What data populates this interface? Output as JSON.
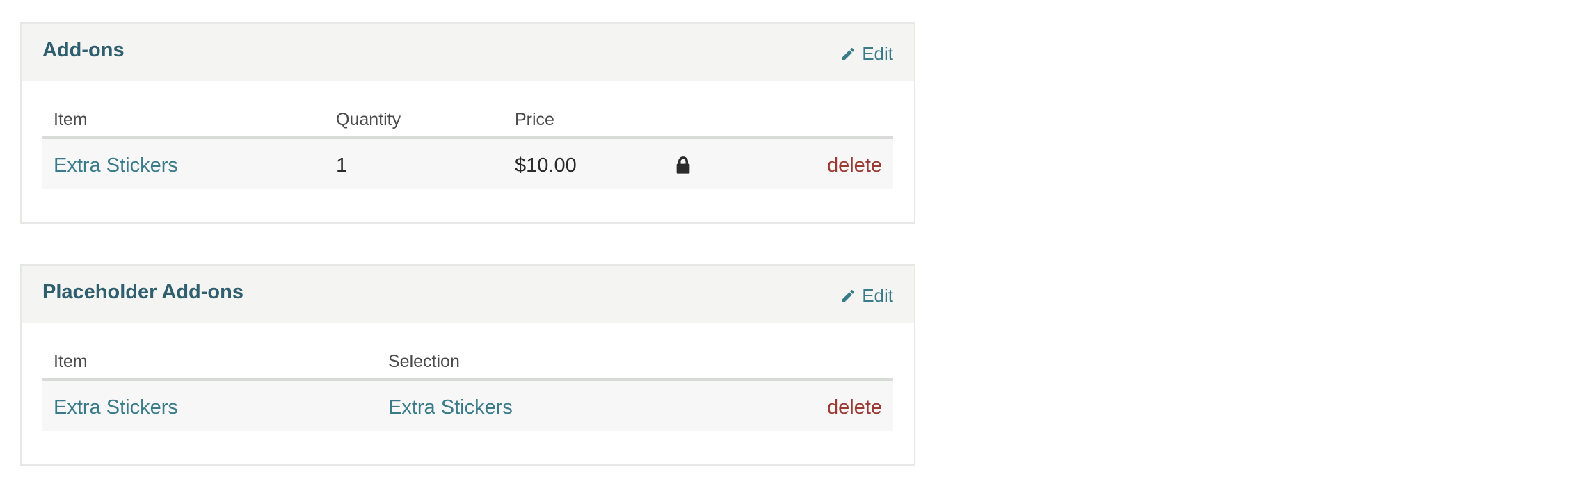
{
  "addons": {
    "title": "Add-ons",
    "edit_label": "Edit",
    "columns": {
      "item": "Item",
      "quantity": "Quantity",
      "price": "Price"
    },
    "rows": [
      {
        "item": "Extra Stickers",
        "quantity": "1",
        "price": "$10.00",
        "locked": true,
        "delete_label": "delete"
      }
    ]
  },
  "placeholder_addons": {
    "title": "Placeholder Add-ons",
    "edit_label": "Edit",
    "columns": {
      "item": "Item",
      "selection": "Selection"
    },
    "rows": [
      {
        "item": "Extra Stickers",
        "selection": "Extra Stickers",
        "delete_label": "delete"
      }
    ]
  },
  "icons": {
    "edit": "pencil-icon",
    "lock": "lock-icon"
  },
  "colors": {
    "title": "#2f5e6e",
    "link": "#3a7b8a",
    "delete": "#9b3a32",
    "header_bg": "#f4f5f3",
    "row_bg": "#f7f7f7"
  }
}
